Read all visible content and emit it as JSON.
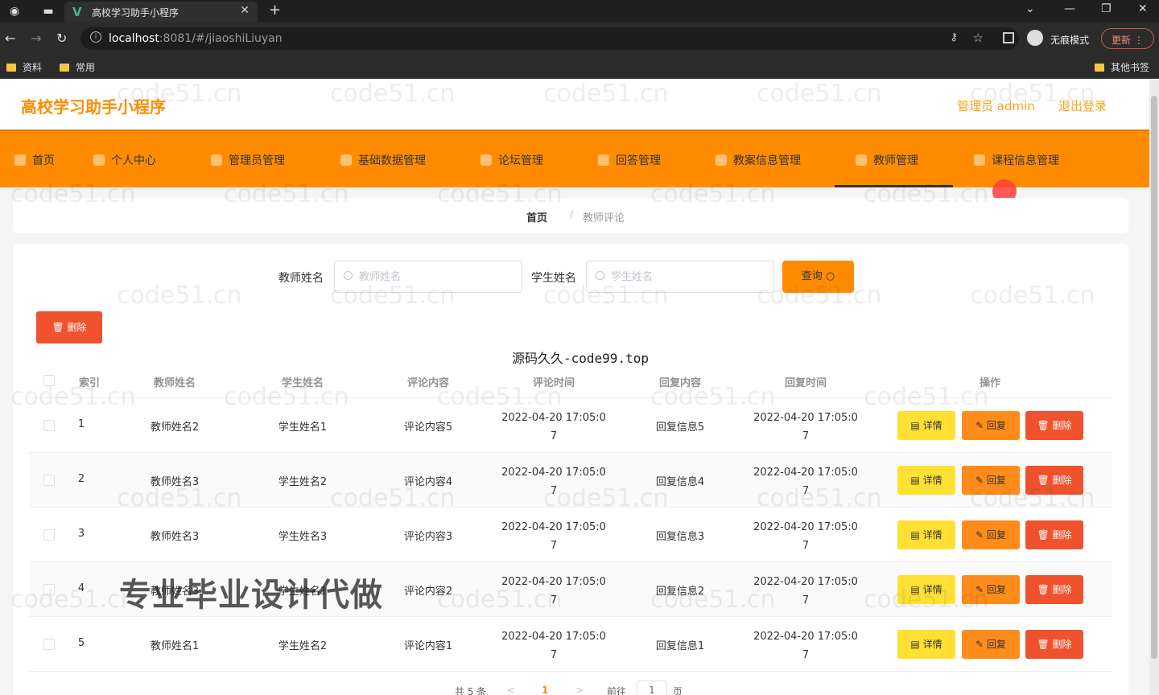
{
  "browser": {
    "tab_title": "高校学习助手小程序",
    "url_host": "localhost",
    "url_path": ":8081/#/jiaoshiLiuyan",
    "incognito_label": "无痕模式",
    "update_label": "更新",
    "bookmarks": [
      "资料",
      "常用"
    ],
    "other_bookmarks": "其他书签"
  },
  "header": {
    "site_title": "高校学习助手小程序",
    "admin_label": "管理员 admin",
    "logout_label": "退出登录"
  },
  "menu": {
    "items": [
      "首页",
      "个人中心",
      "管理员管理",
      "基础数据管理",
      "论坛管理",
      "回答管理",
      "教案信息管理",
      "教师管理",
      "课程信息管理"
    ],
    "active": "教师管理"
  },
  "breadcrumb": {
    "home": "首页",
    "separator": "/",
    "current": "教师评论"
  },
  "search": {
    "teacher_label": "教师姓名",
    "teacher_placeholder": "教师姓名",
    "student_label": "学生姓名",
    "student_placeholder": "学生姓名",
    "query_label": "查询"
  },
  "toolbar": {
    "delete_label": "删除"
  },
  "watermark_text": "源码久久-code99.top",
  "overlay_text": "专业毕业设计代做",
  "repeat_watermark": "code51.cn",
  "table": {
    "headers": [
      "索引",
      "教师姓名",
      "学生姓名",
      "评论内容",
      "评论时间",
      "回复内容",
      "回复时间",
      "操作"
    ],
    "rows": [
      {
        "index": "1",
        "teacher": "教师姓名2",
        "student": "学生姓名1",
        "comment": "评论内容5",
        "comment_time_a": "2022-04-20 17:05:0",
        "comment_time_b": "7",
        "reply": "回复信息5",
        "reply_time_a": "2022-04-20 17:05:0",
        "reply_time_b": "7"
      },
      {
        "index": "2",
        "teacher": "教师姓名3",
        "student": "学生姓名2",
        "comment": "评论内容4",
        "comment_time_a": "2022-04-20 17:05:0",
        "comment_time_b": "7",
        "reply": "回复信息4",
        "reply_time_a": "2022-04-20 17:05:0",
        "reply_time_b": "7"
      },
      {
        "index": "3",
        "teacher": "教师姓名3",
        "student": "学生姓名3",
        "comment": "评论内容3",
        "comment_time_a": "2022-04-20 17:05:0",
        "comment_time_b": "7",
        "reply": "回复信息3",
        "reply_time_a": "2022-04-20 17:05:0",
        "reply_time_b": "7"
      },
      {
        "index": "4",
        "teacher": "教师姓名3",
        "student": "学生姓名1",
        "comment": "评论内容2",
        "comment_time_a": "2022-04-20 17:05:0",
        "comment_time_b": "7",
        "reply": "回复信息2",
        "reply_time_a": "2022-04-20 17:05:0",
        "reply_time_b": "7"
      },
      {
        "index": "5",
        "teacher": "教师姓名1",
        "student": "学生姓名2",
        "comment": "评论内容1",
        "comment_time_a": "2022-04-20 17:05:0",
        "comment_time_b": "7",
        "reply": "回复信息1",
        "reply_time_a": "2022-04-20 17:05:0",
        "reply_time_b": "7"
      }
    ],
    "actions": {
      "detail": "详情",
      "reply": "回复",
      "delete": "删除"
    }
  },
  "pagination": {
    "total": "共 5 条",
    "prev": "<",
    "current_page": "1",
    "next": ">",
    "goto": "前往",
    "page_value": "1",
    "page_unit": "页"
  },
  "colors": {
    "brand": "#ff8c00",
    "detail": "#ffe033",
    "reply": "#ff8c1a",
    "delete": "#f0522e"
  }
}
